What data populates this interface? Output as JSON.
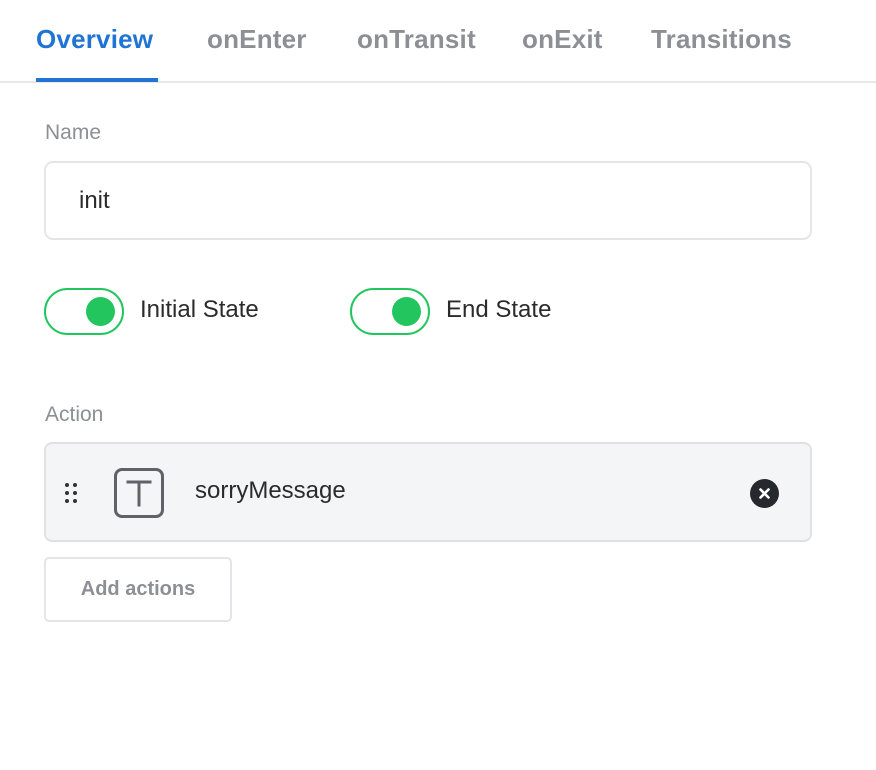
{
  "tabs": [
    {
      "label": "Overview",
      "active": true
    },
    {
      "label": "onEnter",
      "active": false
    },
    {
      "label": "onTransit",
      "active": false
    },
    {
      "label": "onExit",
      "active": false
    },
    {
      "label": "Transitions",
      "active": false
    }
  ],
  "name_field": {
    "label": "Name",
    "value": "init"
  },
  "toggles": [
    {
      "label": "Initial State",
      "on": true
    },
    {
      "label": "End State",
      "on": true
    }
  ],
  "actions_section": {
    "label": "Action",
    "items": [
      {
        "name": "sorryMessage",
        "icon": "text-t-icon"
      }
    ],
    "add_label": "Add actions"
  },
  "colors": {
    "accent": "#1f74d4",
    "toggle_on": "#22c55e",
    "muted_text": "#8c8f94"
  }
}
